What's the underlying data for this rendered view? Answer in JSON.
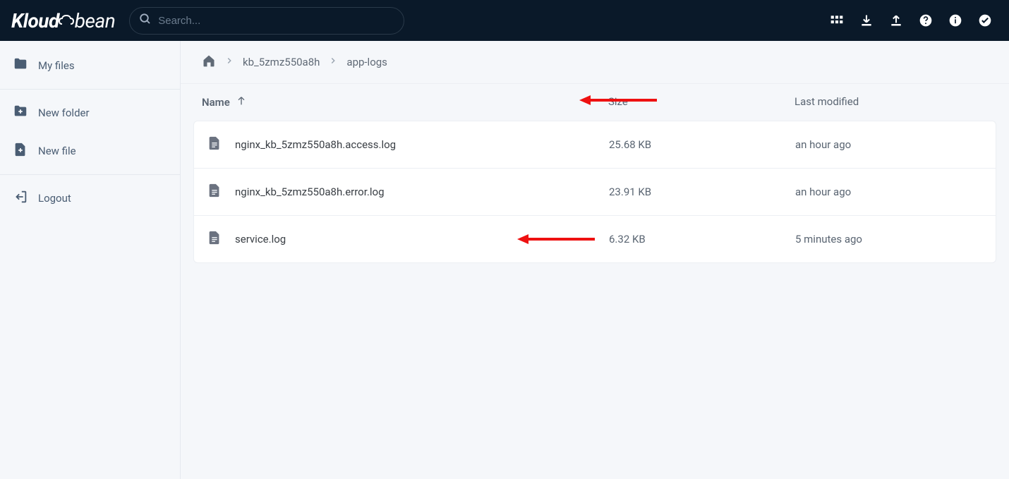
{
  "brand": {
    "part1": "Kloud",
    "part2": "bean"
  },
  "search": {
    "placeholder": "Search..."
  },
  "sidebar": {
    "items": [
      {
        "label": "My files",
        "icon": "folder"
      },
      {
        "label": "New folder",
        "icon": "folder-plus"
      },
      {
        "label": "New file",
        "icon": "file-plus"
      },
      {
        "label": "Logout",
        "icon": "logout"
      }
    ]
  },
  "breadcrumb": {
    "items": [
      {
        "label": "",
        "icon": "home"
      },
      {
        "label": "kb_5zmz550a8h"
      },
      {
        "label": "app-logs"
      }
    ]
  },
  "table": {
    "headers": {
      "name": "Name",
      "size": "Size",
      "modified": "Last modified"
    },
    "rows": [
      {
        "name": "nginx_kb_5zmz550a8h.access.log",
        "size": "25.68 KB",
        "modified": "an hour ago"
      },
      {
        "name": "nginx_kb_5zmz550a8h.error.log",
        "size": "23.91 KB",
        "modified": "an hour ago"
      },
      {
        "name": "service.log",
        "size": "6.32 KB",
        "modified": "5 minutes ago"
      }
    ]
  },
  "header_icons": [
    "apps",
    "download",
    "upload",
    "help",
    "info",
    "check"
  ],
  "annotations": {
    "arrows": [
      {
        "target": "breadcrumb-app-logs",
        "color": "#e11"
      },
      {
        "target": "service.log",
        "color": "#e11"
      }
    ]
  }
}
